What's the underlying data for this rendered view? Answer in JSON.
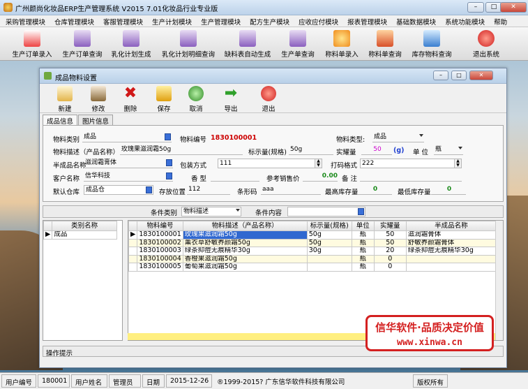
{
  "app": {
    "title": "广州颜尚化妆品ERP生产管理系统  V2015  7.01化妆品行业专业版",
    "win_min": "–",
    "win_max": "□",
    "win_close": "✕"
  },
  "menu": [
    "采购管理模块",
    "仓库管理模块",
    "客服管理模块",
    "生产计划模块",
    "生产管理模块",
    "配方生产模块",
    "应收应付模块",
    "报表管理模块",
    "基础数据模块",
    "系统功能模块",
    "帮助"
  ],
  "toolbar": [
    "生产订单录入",
    "生产订单查询",
    "乳化计划生成",
    "乳化计划明细查询",
    "缺料表自动生成",
    "生产单查询",
    "称料单录入",
    "称料单查询",
    "库存物料查询",
    "退出系统"
  ],
  "child": {
    "title": "成品物料设置",
    "tools": [
      "新建",
      "修改",
      "删除",
      "保存",
      "取消",
      "导出",
      "退出"
    ],
    "tabs": [
      "成品信息",
      "图片信息"
    ]
  },
  "form": {
    "category_label": "物料类别",
    "category_value": "成品",
    "code_label": "物料编号",
    "code_value": "1830100001",
    "type_label": "物料类型:",
    "type_value": "成品",
    "desc_label": "物料描述（产品名称）",
    "desc_value": "玫瑰果滋润霜50g",
    "spec_label": "标示量(规格)",
    "spec_value": "50g",
    "net_label": "实耀量",
    "net_value": "50",
    "net_unit": "(g)",
    "unit_label": "单 位",
    "unit_value": "瓶",
    "semi_label": "半成品名称",
    "semi_value": "滋润霜膏体",
    "pack_label": "包装方式",
    "pack_value": "111",
    "print_label": "打码格式",
    "print_value": "222",
    "cust_label": "客户名称",
    "cust_value": "信华科技",
    "fragrance_label": "香 型",
    "fragrance_value": "",
    "price_label": "参考销售价",
    "price_value": "0.00",
    "note_label": "备 注",
    "note_value": "",
    "wh_label": "默认仓库",
    "wh_value": "成品仓",
    "loc_label": "存放位置",
    "loc_value": "112",
    "barcode_label": "条形码",
    "barcode_value": "aaa",
    "max_label": "最高库存量",
    "max_value": "0",
    "min_label": "最低库存量",
    "min_value": "0"
  },
  "filter": {
    "cond_label": "条件类别",
    "cond_value": "物料描述",
    "content_label": "条件内容",
    "content_value": ""
  },
  "left_grid": {
    "header": "类别名称",
    "rows": [
      "成品"
    ]
  },
  "right_grid": {
    "headers": [
      "物料编号",
      "物料描述（产品名称）",
      "标示量(规格)",
      "单位",
      "实耀量",
      "半成品名称"
    ],
    "rows": [
      [
        "1830100001",
        "玫瑰果滋润霜50g",
        "50g",
        "瓶",
        "50",
        "滋润霜膏体"
      ],
      [
        "1830100002",
        "薰衣草舒敏养颜霜50g",
        "50g",
        "瓶",
        "50",
        "舒敏养颜霜膏体"
      ],
      [
        "1830100003",
        "绿茶抑痘无痕精华30g",
        "30g",
        "瓶",
        "20",
        "绿茶抑痘无痕精华30g"
      ],
      [
        "1830100004",
        "香橙果滋润霜50g",
        "",
        "瓶",
        "0",
        ""
      ],
      [
        "1830100005",
        "葡萄果滋润霜50g",
        "",
        "瓶",
        "0",
        ""
      ]
    ]
  },
  "hint": "操作提示",
  "brand": {
    "line1": "信华软件·品质决定价值",
    "line2": "www.xinwa.cn"
  },
  "status": {
    "user_code_label": "用户编号",
    "user_code": "180001",
    "user_name_label": "用户姓名",
    "user_name": "管理员",
    "date_label": "日期",
    "date": "2015-12-26",
    "copyright": "®1999-2015?  广东信华软件科技有限公司",
    "rights": "版权所有"
  }
}
